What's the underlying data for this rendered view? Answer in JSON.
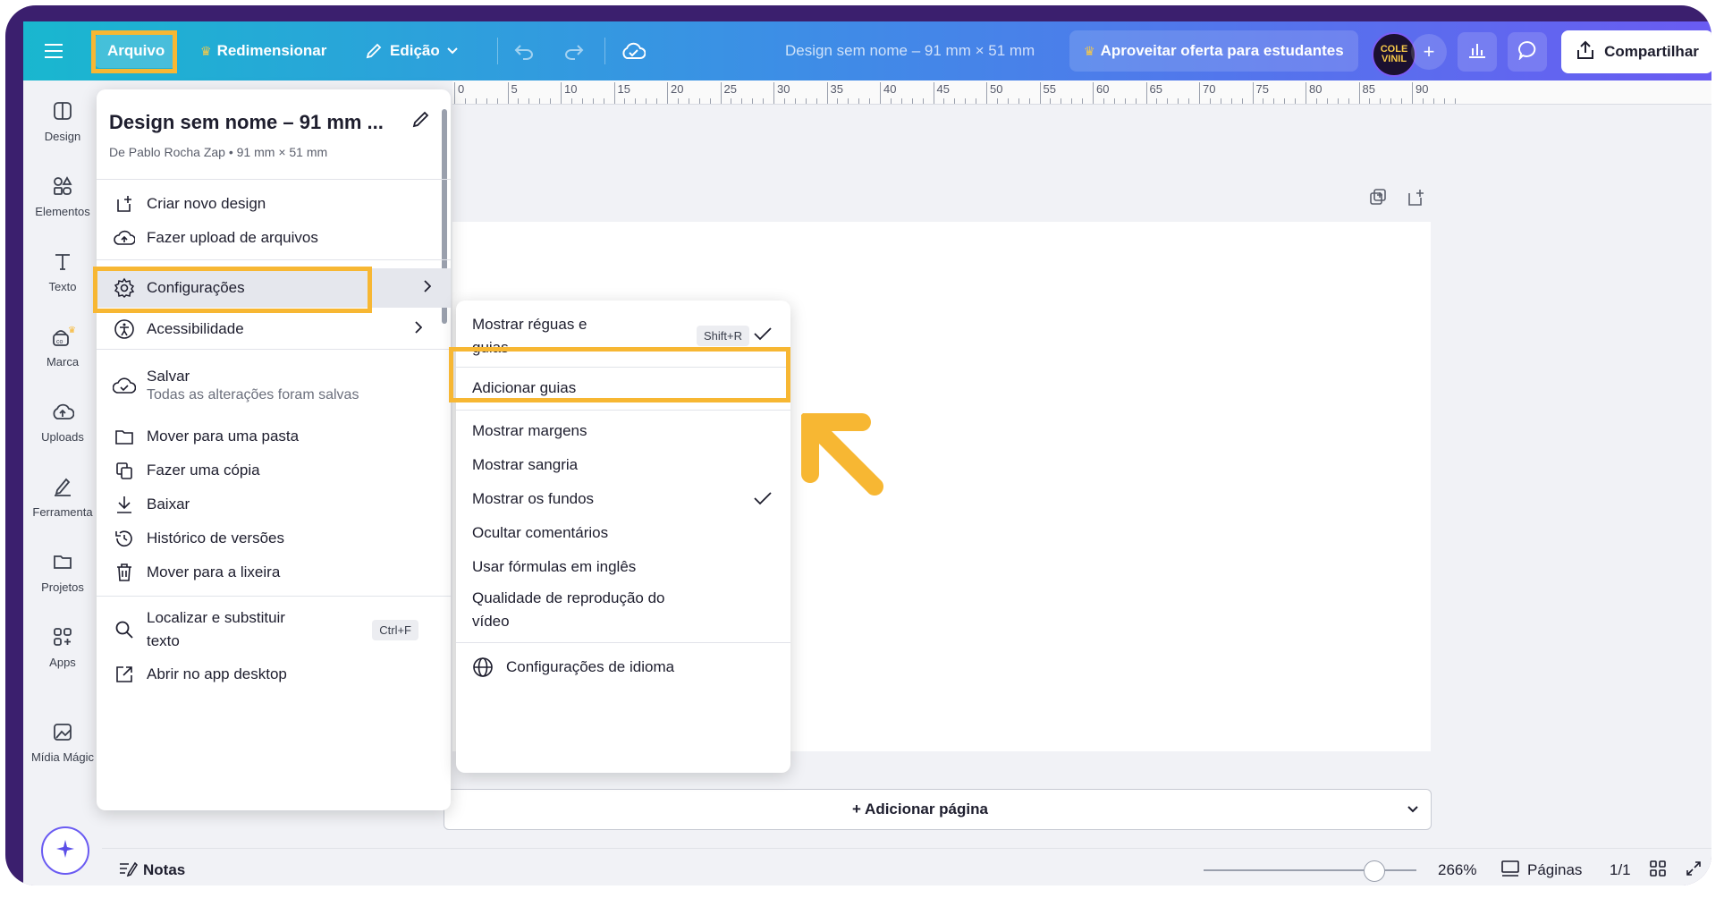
{
  "topbar": {
    "menu_label": "Arquivo",
    "resize_label": "Redimensionar",
    "edit_label": "Edição",
    "doc_title": "Design sem nome – 91 mm × 51 mm",
    "offer_label": "Aproveitar oferta para estudantes",
    "avatar_text": "COLE VINIL",
    "share_label": "Compartilhar"
  },
  "sidebar": {
    "items": [
      {
        "label": "Design",
        "icon": "layout-icon"
      },
      {
        "label": "Elementos",
        "icon": "shapes-icon"
      },
      {
        "label": "Texto",
        "icon": "text-icon"
      },
      {
        "label": "Marca",
        "icon": "brand-icon"
      },
      {
        "label": "Uploads",
        "icon": "cloud-upload-icon"
      },
      {
        "label": "Ferramenta",
        "icon": "pen-tool-icon"
      },
      {
        "label": "Projetos",
        "icon": "folder-icon"
      },
      {
        "label": "Apps",
        "icon": "apps-icon"
      },
      {
        "label": "Mídia Mágic",
        "icon": "magic-media-icon"
      }
    ]
  },
  "ruler": {
    "labels": [
      "0",
      "5",
      "10",
      "15",
      "20",
      "25",
      "30",
      "35",
      "40",
      "45",
      "50",
      "55",
      "60",
      "65",
      "70",
      "75",
      "80",
      "85",
      "90"
    ]
  },
  "file_menu": {
    "title": "Design sem nome – 91 mm ...",
    "subtitle": "De Pablo Rocha Zap • 91 mm × 51 mm",
    "items": {
      "create": "Criar novo design",
      "upload": "Fazer upload de arquivos",
      "settings": "Configurações",
      "accessibility": "Acessibilidade",
      "save": "Salvar",
      "save_status": "Todas as alterações foram salvas",
      "move_folder": "Mover para uma pasta",
      "copy": "Fazer uma cópia",
      "download": "Baixar",
      "history": "Histórico de versões",
      "trash": "Mover para a lixeira",
      "find_line1": "Localizar e substituir",
      "find_line2": "texto",
      "find_shortcut": "Ctrl+F",
      "desktop": "Abrir no app desktop"
    }
  },
  "settings_submenu": {
    "rulers_line1": "Mostrar réguas e",
    "rulers_line2": "guias",
    "rulers_shortcut": "Shift+R",
    "rulers_checked": true,
    "add_guides": "Adicionar guias",
    "margins": "Mostrar margens",
    "bleed": "Mostrar sangria",
    "backgrounds": "Mostrar os fundos",
    "backgrounds_checked": true,
    "hide_comments": "Ocultar comentários",
    "english_formulas": "Usar fórmulas em inglês",
    "video_quality_line1": "Qualidade de reprodução do",
    "video_quality_line2": "vídeo",
    "language": "Configurações de idioma"
  },
  "canvas": {
    "add_page_label": "+ Adicionar página"
  },
  "bottombar": {
    "notes_label": "Notas",
    "zoom": "266%",
    "zoom_fraction": 0.8,
    "pages_label": "Páginas",
    "page_count": "1/1"
  },
  "colors": {
    "highlight": "#f7b733",
    "brand_gradient_start": "#19b7cf",
    "brand_gradient_end": "#6a5bf2",
    "frame": "#3b1f6e"
  }
}
